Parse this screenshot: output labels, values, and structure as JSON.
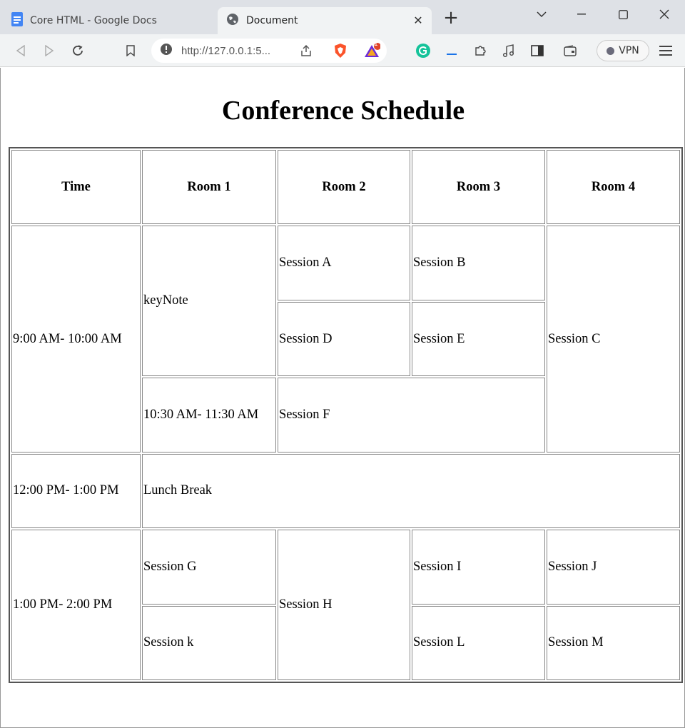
{
  "browser": {
    "tabs": [
      {
        "title": "Core HTML - Google Docs",
        "icon": "google-docs-icon"
      },
      {
        "title": "Document",
        "icon": "globe-icon"
      }
    ],
    "url": "http://127.0.0.1:5...",
    "vpn_label": "VPN",
    "brave_badge_count": "1"
  },
  "page": {
    "title": "Conference Schedule",
    "headers": [
      "Time",
      "Room 1",
      "Room 2",
      "Room 3",
      "Room 4"
    ],
    "slot1": {
      "time": "9:00 AM- 10:00 AM",
      "keynote": "keyNote",
      "session_a": "Session A",
      "session_b": "Session B",
      "session_c": "Session C",
      "session_d": "Session D",
      "session_e": "Session E",
      "time2": "10:30 AM- 11:30 AM",
      "session_f": "Session F"
    },
    "lunch": {
      "time": "12:00 PM- 1:00 PM",
      "label": "Lunch Break"
    },
    "slot3": {
      "time": "1:00 PM- 2:00 PM",
      "session_g": "Session G",
      "session_h": "Session H",
      "session_i": "Session I",
      "session_j": "Session J",
      "session_k": "Session k",
      "session_l": "Session L",
      "session_m": "Session M"
    }
  }
}
